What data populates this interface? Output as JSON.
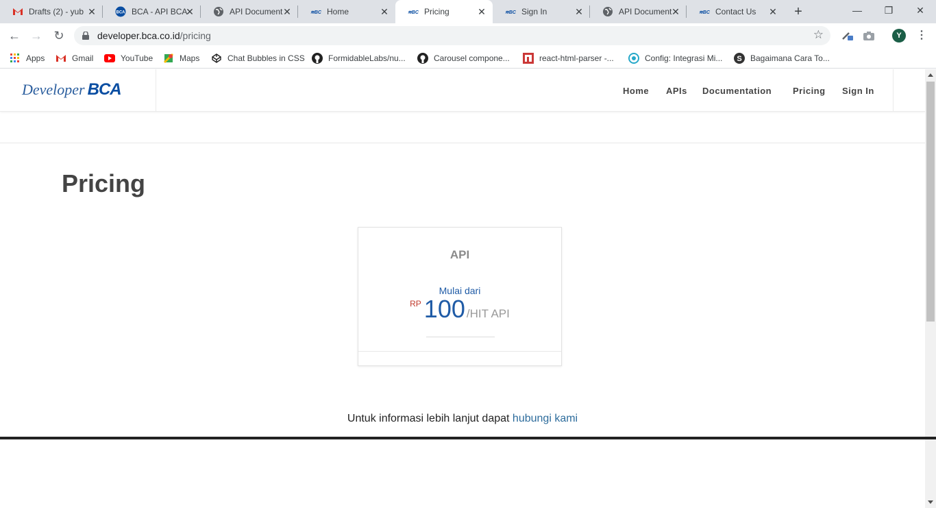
{
  "browser": {
    "tabs": [
      {
        "title": "Drafts (2) - yub",
        "icon": "gmail-icon",
        "active": false
      },
      {
        "title": "BCA - API BCA",
        "icon": "bca-icon",
        "active": false
      },
      {
        "title": "API Document",
        "icon": "globe-icon",
        "active": false
      },
      {
        "title": "Home",
        "icon": "bca-icon",
        "active": false
      },
      {
        "title": "Pricing",
        "icon": "bca-icon",
        "active": true
      },
      {
        "title": "Sign In",
        "icon": "bca-icon",
        "active": false
      },
      {
        "title": "API Document",
        "icon": "globe-icon",
        "active": false
      },
      {
        "title": "Contact Us",
        "icon": "bca-icon",
        "active": false
      }
    ],
    "url_host": "developer.bca.co.id",
    "url_path": "/pricing",
    "avatar_letter": "Y",
    "bookmarks": [
      {
        "label": "Apps",
        "icon": "apps-grid-icon"
      },
      {
        "label": "Gmail",
        "icon": "gmail-icon"
      },
      {
        "label": "YouTube",
        "icon": "youtube-icon"
      },
      {
        "label": "Maps",
        "icon": "maps-icon"
      },
      {
        "label": "Chat Bubbles in CSS",
        "icon": "codepen-icon"
      },
      {
        "label": "FormidableLabs/nu...",
        "icon": "github-icon"
      },
      {
        "label": "Carousel compone...",
        "icon": "github-icon"
      },
      {
        "label": "react-html-parser -...",
        "icon": "npm-icon"
      },
      {
        "label": "Config: Integrasi Mi...",
        "icon": "config-icon"
      },
      {
        "label": "Bagaimana Cara To...",
        "icon": "s-icon"
      }
    ]
  },
  "site": {
    "logo_developer": "Developer",
    "logo_bca": "BCA",
    "nav": [
      "Home",
      "APIs",
      "Documentation",
      "Pricing",
      "Sign In"
    ],
    "page_title": "Pricing",
    "card": {
      "title": "API",
      "from_label": "Mulai dari",
      "currency": "RP",
      "amount": "100",
      "unit": "/HIT API"
    },
    "info_text": "Untuk informasi lebih lanjut dapat ",
    "info_link": "hubungi kami"
  },
  "colors": {
    "brand_blue": "#1f5ba6",
    "currency_red": "#c0392b",
    "link_blue": "#2d6c9c"
  }
}
